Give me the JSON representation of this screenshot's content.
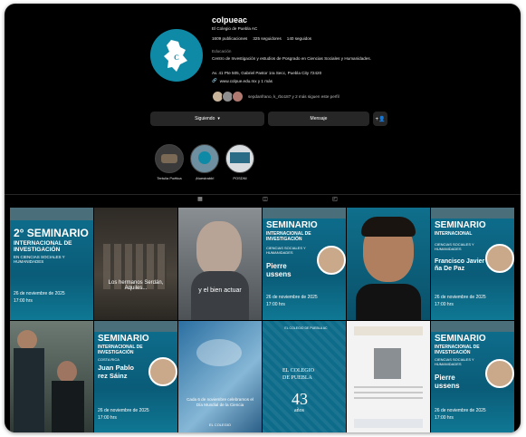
{
  "profile": {
    "username": "colpueac",
    "full_name": "El Colegio de Puebla AC",
    "stats": {
      "posts": "1609 publicaciones",
      "followers": "325 seguidores",
      "following": "140 seguidos"
    },
    "category": "Educación",
    "bio": "Centro de Investigación y estudios de Posgrado en Ciencias Sociales y Humanidades.",
    "address": "Av. 41 Pte 505, Gabriel Pastor 1ra Secc, Puebla City 72420",
    "link": "www.colpue.edu.mx y 1 más",
    "followed_by": "sepdanfrano, k_rbo187 y 2 más siguen este perfil"
  },
  "buttons": {
    "following": "Siguiendo",
    "message": "Mensaje",
    "add_user_icon": "+person"
  },
  "highlights": [
    {
      "label": "Tertulia Poética"
    },
    {
      "label": "¡Nuestrabb!"
    },
    {
      "label": "POSDNI"
    }
  ],
  "tabs": [
    "grid-icon",
    "reels-icon",
    "tagged-icon"
  ],
  "posts": [
    {
      "title": "2° SEMINARIO",
      "subtitle": "INTERNACIONAL DE INVESTIGACIÓN",
      "tagline": "EN CIENCIAS SOCIALES Y HUMANIDADES",
      "date": "26 de noviembre de 2025",
      "time": "17:00 hrs"
    },
    {
      "caption": "Los hermanos Serdán, Aquiles..."
    },
    {
      "caption": "y el bien actuar"
    },
    {
      "title": "SEMINARIO",
      "subtitle": "INTERNACIONAL DE INVESTIGACIÓN",
      "tagline": "CIENCIAS SOCIALES Y HUMANIDADES",
      "name": "Pierre\nussens",
      "date": "26 de noviembre de 2025",
      "time": "17:00 hrs"
    },
    {
      "caption": ""
    },
    {
      "title": "SEMINARIO",
      "subtitle": "INTERNACIONAL",
      "tagline": "CIENCIAS SOCIALES Y HUMANIDADES",
      "name": "Francisco Javier\nña De Paz",
      "date": "26 de noviembre de 2025",
      "time": "17:00 hrs"
    },
    {
      "caption": ""
    },
    {
      "title": "SEMINARIO",
      "subtitle": "INTERNACIONAL DE INVESTIGACIÓN",
      "tagline": "COSTA RICA",
      "name": "Juan Pablo\nrez Sáinz",
      "date": "26 de noviembre de 2025",
      "time": "17:00 hrs"
    },
    {
      "caption": "Cada 6 de noviembre celebramos el Día Mundial de la Ciencia",
      "footer": "EL COLEGIO"
    },
    {
      "header": "EL COLEGIO DE PUEBLA AC",
      "title": "EL COLEGIO",
      "subtitle": "DE PUEBLA",
      "big": "43",
      "sub": "años"
    },
    {
      "caption": ""
    },
    {
      "title": "SEMINARIO",
      "subtitle": "INTERNACIONAL DE INVESTIGACIÓN",
      "tagline": "CIENCIAS SOCIALES Y HUMANIDADES",
      "name": "Pierre\nussens",
      "date": "26 de noviembre de 2025",
      "time": "17:00 hrs"
    }
  ],
  "colors": {
    "background": "#000000",
    "accent_teal": "#0f8aa6",
    "button": "#262626"
  }
}
